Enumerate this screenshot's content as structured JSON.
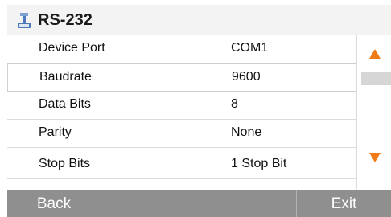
{
  "title": {
    "text": "RS-232",
    "icon": "serial-port-icon"
  },
  "rows": [
    {
      "label": "Device Port",
      "value": "COM1"
    },
    {
      "label": "Baudrate",
      "value": "9600"
    },
    {
      "label": "Data Bits",
      "value": "8"
    },
    {
      "label": "Parity",
      "value": "None"
    },
    {
      "label": "Stop Bits",
      "value": "1 Stop Bit"
    }
  ],
  "scroll": {
    "up_icon": "arrow-up-icon",
    "down_icon": "arrow-down-icon",
    "arrow_color": "#f07b16"
  },
  "footer": {
    "back_label": "Back",
    "exit_label": "Exit",
    "bar_color": "#8f8f8f"
  }
}
